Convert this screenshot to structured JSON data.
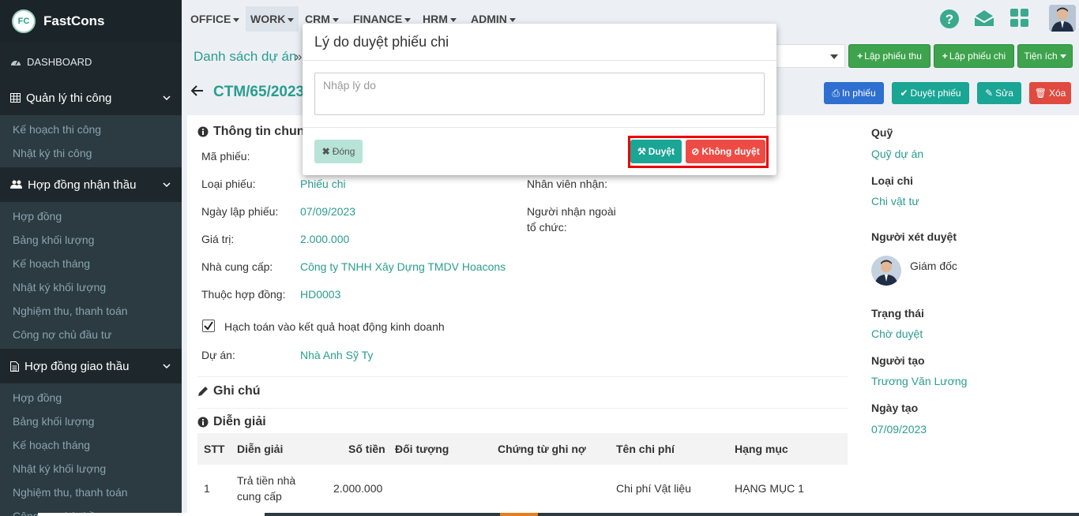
{
  "app": {
    "name": "FastCons",
    "logo_text": "FC"
  },
  "sidebar": {
    "dashboard": "DASHBOARD",
    "groups": [
      {
        "label": "Quản lý thi công",
        "items": [
          "Kế hoạch thi công",
          "Nhật ký thi công"
        ]
      },
      {
        "label": "Hợp đồng nhận thầu",
        "items": [
          "Hợp đồng",
          "Bảng khối lượng",
          "Kế hoạch tháng",
          "Nhật ký khối lượng",
          "Nghiệm thu, thanh toán",
          "Công nợ chủ đầu tư"
        ]
      },
      {
        "label": "Hợp đồng giao thầu",
        "items": [
          "Hợp đồng",
          "Bảng khối lượng",
          "Kế hoạch tháng",
          "Nhật ký khối lượng",
          "Nghiệm thu, thanh toán",
          "Công nợ nhà thầu"
        ]
      }
    ]
  },
  "topnav": {
    "items": [
      "OFFICE",
      "WORK",
      "CRM",
      "FINANCE",
      "HRM",
      "ADMIN"
    ],
    "active": "WORK"
  },
  "toolbar": {
    "breadcrumb": "Danh sách dự án",
    "breadcrumb_sep": "»",
    "btn_receipt": "Lập phiếu thu",
    "btn_payment": "Lập phiếu chi",
    "btn_utils": "Tiện ích",
    "doc_code": "CTM/65/2023",
    "btn_print": "In phiếu",
    "btn_approve_doc": "Duyệt phiếu",
    "btn_edit": "Sửa",
    "btn_delete": "Xóa"
  },
  "general": {
    "title": "Thông tin chung",
    "rows": [
      {
        "label": "Mã phiếu:",
        "value": ""
      },
      {
        "label": "Loại phiếu:",
        "value": "Phiếu chi"
      },
      {
        "label": "Ngày lập phiếu:",
        "value": "07/09/2023"
      },
      {
        "label": "Giá trị:",
        "value": "2.000.000"
      },
      {
        "label": "Nhà cung cấp:",
        "value": "Công ty TNHH Xây Dựng TMDV Hoacons"
      },
      {
        "label": "Thuộc hợp đồng:",
        "value": "HD0003"
      }
    ],
    "right_labels": [
      "Nhân viên nhận:",
      "Người nhận ngoài",
      "tổ chức:"
    ],
    "checkbox_label": "Hạch toán vào kết quả hoạt động kinh doanh",
    "project_label": "Dự án:",
    "project_value": "Nhà Anh Sỹ Ty"
  },
  "notes": {
    "title": "Ghi chú"
  },
  "details": {
    "title": "Diễn giải",
    "columns": [
      "STT",
      "Diễn giải",
      "Số tiền",
      "Đối tượng",
      "Chứng từ ghi nợ",
      "Tên chi phí",
      "Hạng mục"
    ],
    "rows": [
      {
        "stt": "1",
        "desc_line1": "Trả tiền nhà",
        "desc_line2": "cung cấp",
        "amount": "2.000.000",
        "object": "",
        "voucher": "",
        "cost_name": "Chi phí Vật liệu",
        "item": "HẠNG MỤC 1"
      }
    ]
  },
  "side": {
    "fund_label": "Quỹ",
    "fund_value": "Quỹ dự án",
    "type_label": "Loại chi",
    "type_value": "Chi vật tư",
    "approver_label": "Người xét duyệt",
    "approver_value": "Giám đốc",
    "status_label": "Trạng thái",
    "status_value": "Chờ duyệt",
    "creator_label": "Người tạo",
    "creator_value": "Trương Văn Lương",
    "date_label": "Ngày tạo",
    "date_value": "07/09/2023"
  },
  "modal": {
    "title": "Lý do duyệt phiếu chi",
    "placeholder": "Nhập lý do",
    "value": "",
    "btn_close": "Đóng",
    "btn_approve": "Duyệt",
    "btn_reject": "Không duyệt"
  },
  "colors": {
    "accent": "#2a9d8f",
    "sidebar": "#222d32",
    "approve": "#1aa595",
    "reject": "#ef4b45",
    "highlight": "#ee0000"
  }
}
